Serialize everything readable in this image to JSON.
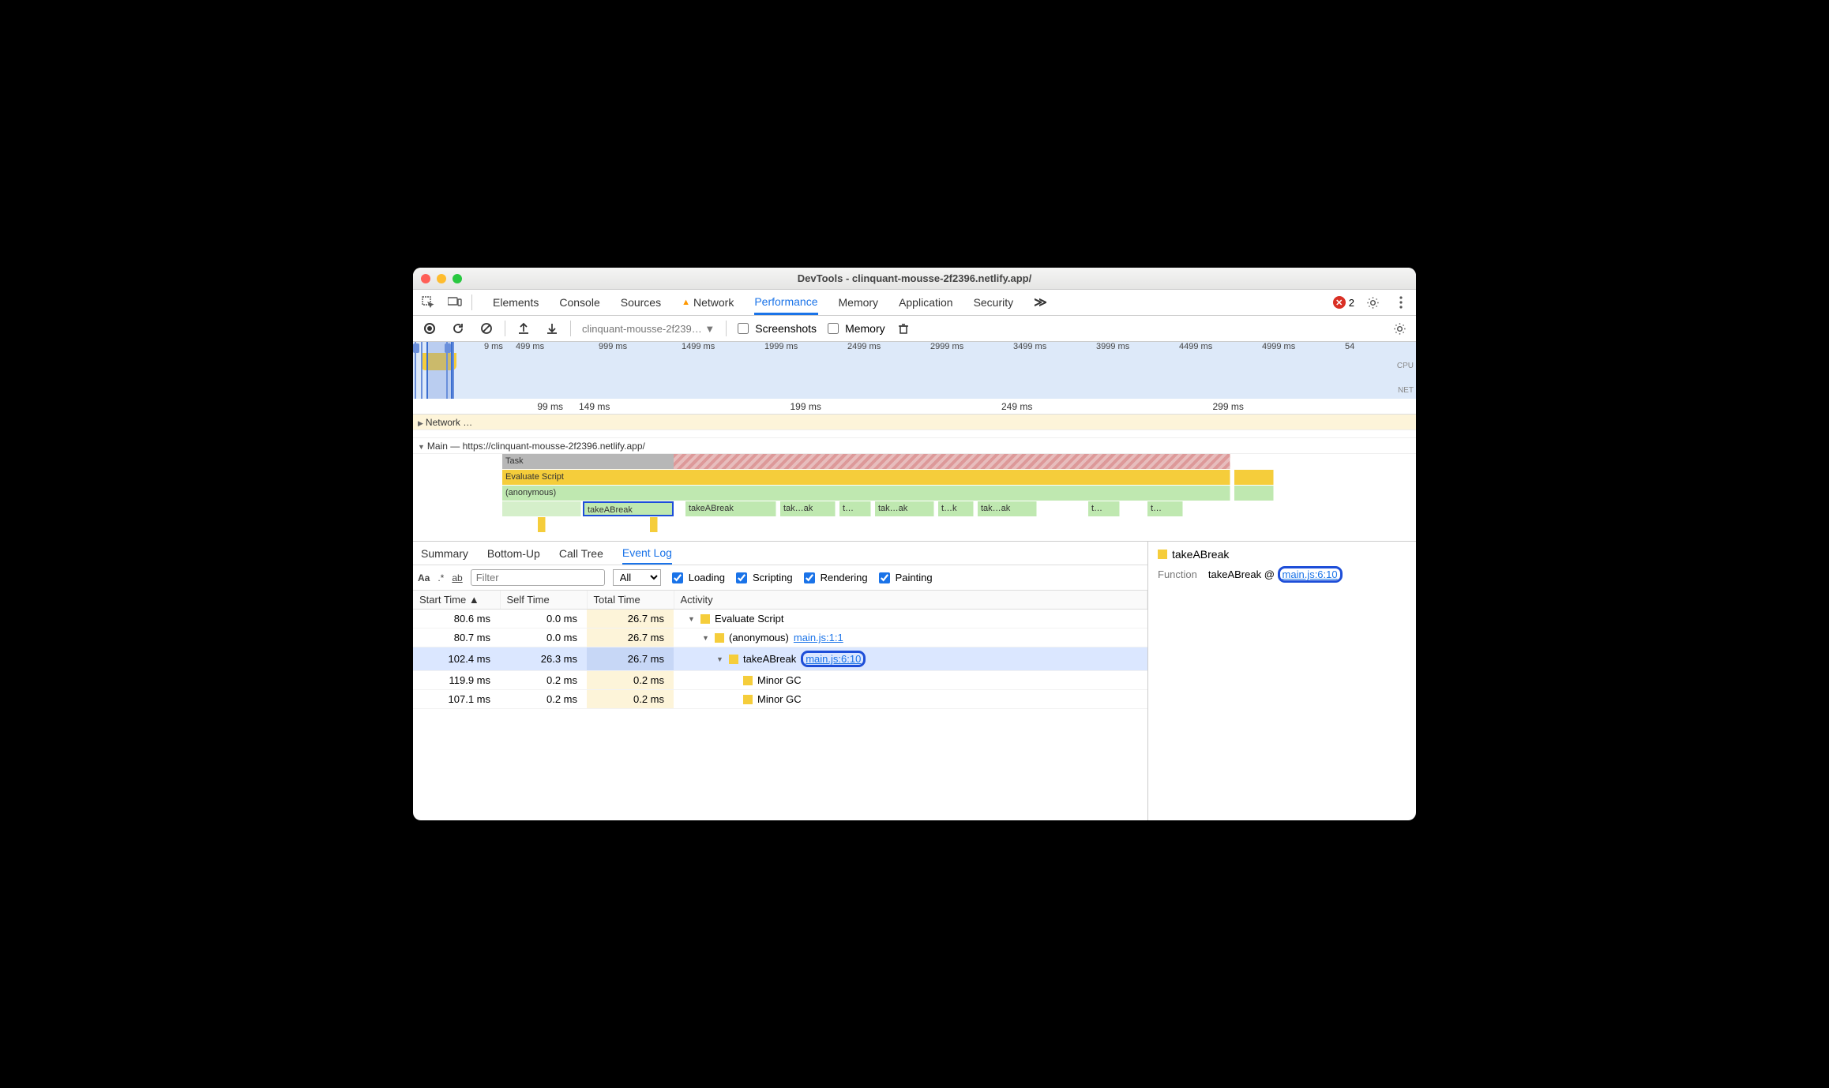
{
  "window": {
    "title": "DevTools - clinquant-mousse-2f2396.netlify.app/"
  },
  "mainTabs": [
    "Elements",
    "Console",
    "Sources",
    "Network",
    "Performance",
    "Memory",
    "Application",
    "Security"
  ],
  "mainTabActive": "Performance",
  "networkWarn": true,
  "overflowGlyph": "≫",
  "errorCount": "2",
  "toolbar": {
    "profileSelect": "clinquant-mousse-2f239… ▼",
    "screenshots": "Screenshots",
    "memory": "Memory"
  },
  "overviewTicks": [
    "9 ms",
    "499 ms",
    "999 ms",
    "1499 ms",
    "1999 ms",
    "2499 ms",
    "2999 ms",
    "3499 ms",
    "3999 ms",
    "4499 ms",
    "4999 ms",
    "54"
  ],
  "overviewCPU": "CPU",
  "overviewNET": "NET",
  "detailTicks": [
    "99 ms",
    "149 ms",
    "199 ms",
    "249 ms",
    "299 ms"
  ],
  "tracks": {
    "network": "Network …",
    "mainLabel": "Main — https://clinquant-mousse-2f2396.netlify.app/"
  },
  "flame": {
    "task": "Task",
    "eval": "Evaluate Script",
    "anon": "(anonymous)",
    "calls": [
      "takeABreak",
      "takeABreak",
      "tak…ak",
      "t…",
      "tak…ak",
      "t…k",
      "tak…ak",
      "t…",
      "t…"
    ]
  },
  "subtabs": [
    "Summary",
    "Bottom-Up",
    "Call Tree",
    "Event Log"
  ],
  "subtabActive": "Event Log",
  "filterBar": {
    "aa": "Aa",
    "regex": ".*",
    "ab": "ab",
    "filterPlaceholder": "Filter",
    "all": "All",
    "loading": "Loading",
    "scripting": "Scripting",
    "rendering": "Rendering",
    "painting": "Painting"
  },
  "columns": {
    "start": "Start Time ▲",
    "self": "Self Time",
    "total": "Total Time",
    "activity": "Activity"
  },
  "rows": [
    {
      "start": "80.6 ms",
      "self": "0.0 ms",
      "total": "26.7 ms",
      "indent": 0,
      "expand": "▼",
      "name": "Evaluate Script",
      "src": ""
    },
    {
      "start": "80.7 ms",
      "self": "0.0 ms",
      "total": "26.7 ms",
      "indent": 1,
      "expand": "▼",
      "name": "(anonymous)",
      "src": "main.js:1:1"
    },
    {
      "start": "102.4 ms",
      "self": "26.3 ms",
      "total": "26.7 ms",
      "indent": 2,
      "expand": "▼",
      "name": "takeABreak",
      "src": "main.js:6:10",
      "selected": true,
      "ring": true
    },
    {
      "start": "119.9 ms",
      "self": "0.2 ms",
      "total": "0.2 ms",
      "indent": 3,
      "expand": "",
      "name": "Minor GC",
      "src": ""
    },
    {
      "start": "107.1 ms",
      "self": "0.2 ms",
      "total": "0.2 ms",
      "indent": 3,
      "expand": "",
      "name": "Minor GC",
      "src": ""
    }
  ],
  "side": {
    "title": "takeABreak",
    "funcLabel": "Function",
    "funcName": "takeABreak @",
    "funcSrc": "main.js:6:10"
  }
}
